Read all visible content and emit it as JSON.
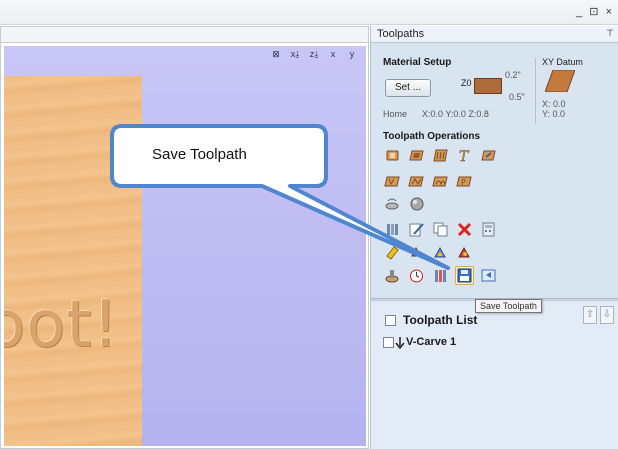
{
  "window": {
    "controls": "_ ⊡ ×"
  },
  "viewport": {
    "carved_text": "oot!",
    "view_icons": [
      "⊠",
      "x⤓",
      "z⤓",
      "x",
      "y"
    ]
  },
  "panel": {
    "title": "Toolpaths",
    "pin": "⊤",
    "material_setup": {
      "title": "Material Setup",
      "set_button": "Set ...",
      "z0_label": "Z0",
      "thickness_top": "0.2\"",
      "thickness_bottom": "0.5\"",
      "home_label": "Home",
      "home_values": "X:0.0 Y:0.0 Z:0.8",
      "xy_datum_title": "XY Datum",
      "xy_x": "X: 0.0",
      "xy_y": "Y: 0.0"
    },
    "ops_title": "Toolpath Operations",
    "toolpath_list": {
      "title": "Toolpath List",
      "items": [
        {
          "label": "V-Carve 1"
        }
      ]
    }
  },
  "tooltip": {
    "text": "Save Toolpath"
  },
  "callout": {
    "text": "Save Toolpath"
  },
  "colors": {
    "viewport_bg": "#c9c6f7",
    "panel_bg": "#d9e4f1",
    "callout_fill": "#ffffff",
    "callout_stroke": "#4f86cf",
    "accent": "#e3a93a"
  }
}
